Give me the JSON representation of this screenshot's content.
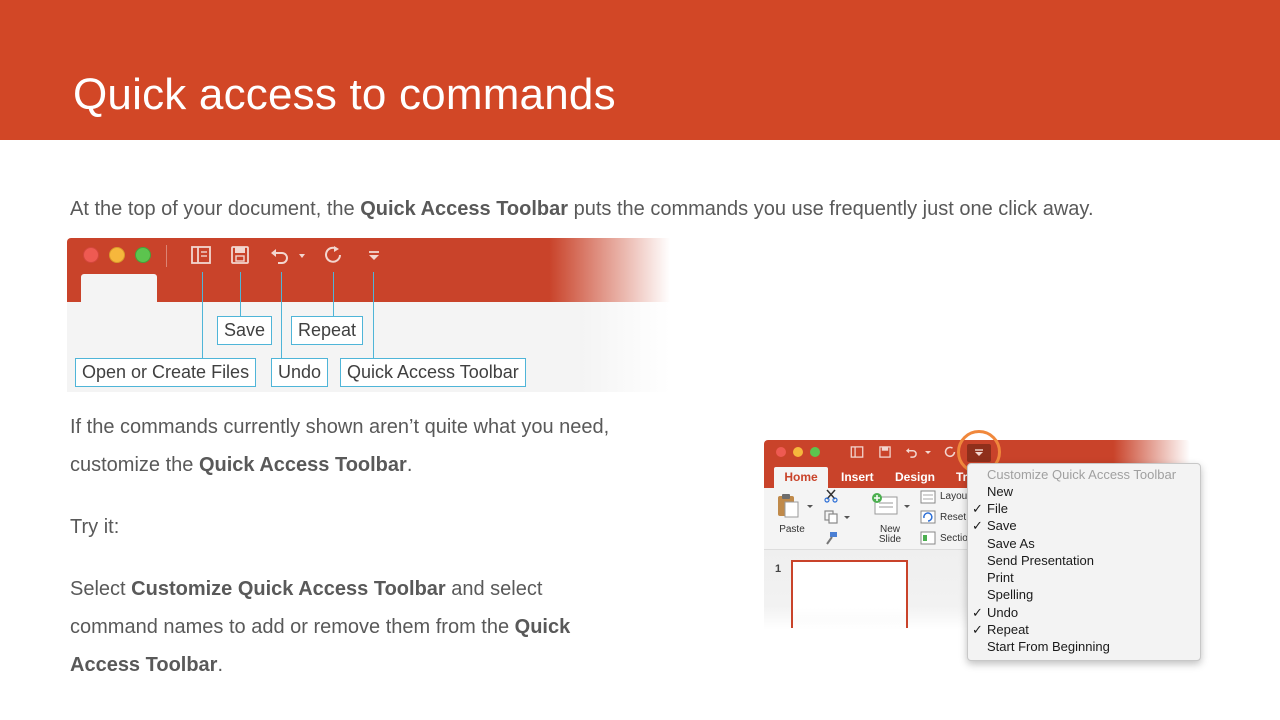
{
  "slide": {
    "title": "Quick access to commands",
    "intro": {
      "pre": "At the top of your document, the ",
      "bold": "Quick Access Toolbar",
      "post": " puts the commands you use frequently just one click away."
    },
    "callouts": {
      "save": "Save",
      "repeat": "Repeat",
      "open_create": "Open or Create Files",
      "undo": "Undo",
      "qat": "Quick Access Toolbar"
    },
    "para1": {
      "pre": "If the commands currently shown aren’t quite what you need, customize the ",
      "bold": "Quick Access Toolbar",
      "post": "."
    },
    "para2": "Try it:",
    "para3": {
      "pre": "Select ",
      "bold1": "Customize Quick Access Toolbar",
      "mid": " and select command names to add or remove them from the ",
      "bold2": "Quick Access Toolbar",
      "post": "."
    }
  },
  "screenshot": {
    "tabs": [
      "Home",
      "Insert",
      "Design",
      "Tr"
    ],
    "ribbon": {
      "paste": "Paste",
      "new_slide": [
        "New",
        "Slide"
      ],
      "layout": "Layou",
      "reset": "Reset",
      "section": "Sectio"
    },
    "slide_number": "1",
    "menu": {
      "header": "Customize Quick Access Toolbar",
      "items": [
        {
          "label": "New",
          "checked": false
        },
        {
          "label": "File",
          "checked": true
        },
        {
          "label": "Save",
          "checked": true
        },
        {
          "label": "Save As",
          "checked": false
        },
        {
          "label": "Send Presentation",
          "checked": false
        },
        {
          "label": "Print",
          "checked": false
        },
        {
          "label": "Spelling",
          "checked": false
        },
        {
          "label": "Undo",
          "checked": true
        },
        {
          "label": "Repeat",
          "checked": true
        },
        {
          "label": "Start From Beginning",
          "checked": false
        }
      ],
      "check_glyph": "✓"
    }
  },
  "colors": {
    "brand": "#d24726",
    "toolbar": "#c9432a",
    "callout_border": "#4fb5d8",
    "highlight_ring": "#f0883c"
  },
  "icons": [
    "open-files-icon",
    "save-icon",
    "undo-icon",
    "repeat-icon",
    "dropdown-icon"
  ]
}
